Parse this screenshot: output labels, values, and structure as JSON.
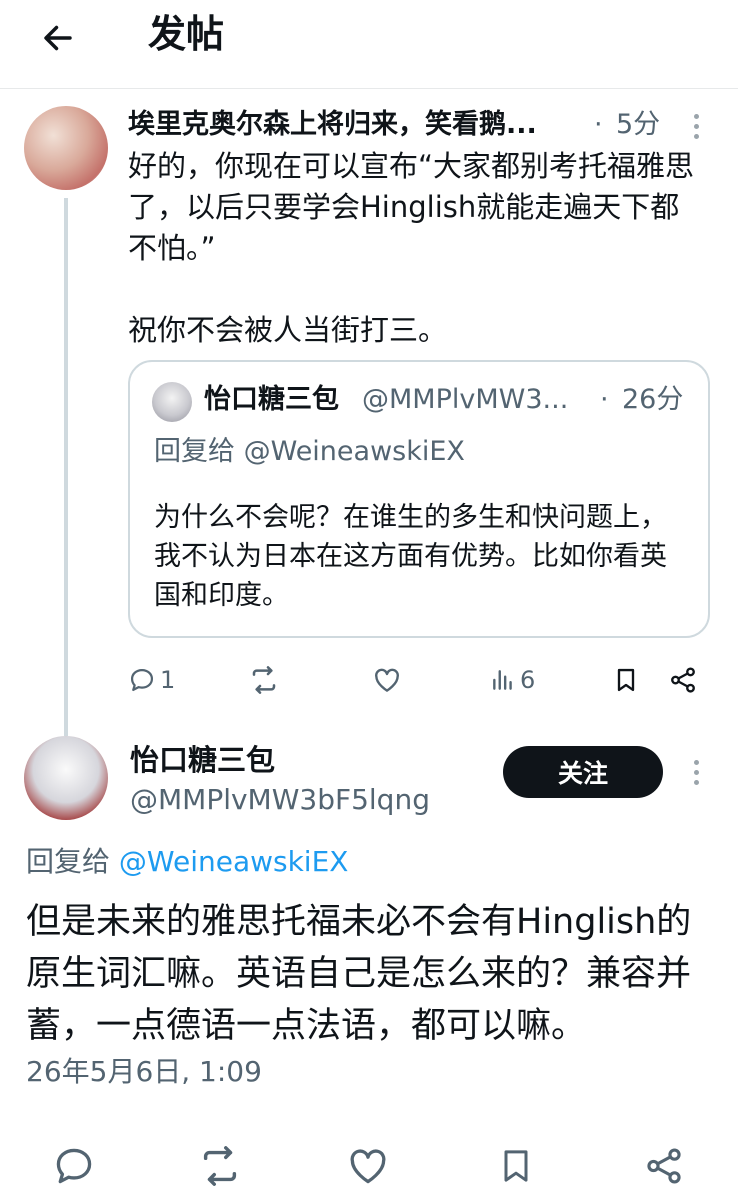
{
  "header": {
    "title": "发帖"
  },
  "parent_post": {
    "display_name": "埃里克奥尔森上将归来，笑看鹅...",
    "separator": "·",
    "time": "5分",
    "text": "好的，你现在可以宣布“大家都别考托福雅思了，以后只要学会Hinglish就能走遍天下都不怕。”\n\n祝你不会被人当街打三。",
    "quote": {
      "display_name": "怡口糖三包",
      "handle": "@MMPlvMW3...",
      "separator": "·",
      "time": "26分",
      "reply_to": "回复给 @WeineawskiEX",
      "text": "为什么不会呢？在谁生的多生和快问题上，我不认为日本在这方面有优势。比如你看英国和印度。"
    },
    "actions": {
      "reply_count": "1",
      "views_count": "6"
    }
  },
  "main_post": {
    "display_name": "怡口糖三包",
    "handle": "@MMPlvMW3bF5lqng",
    "follow_label": "关注",
    "reply_prefix": "回复给",
    "reply_mention": "@WeineawskiEX",
    "text": "但是未来的雅思托福未必不会有Hinglish的原生词汇嘛。英语自己是怎么来的？兼容并蓄，一点德语一点法语，都可以嘛。",
    "timestamp": "26年5月6日, 1:09"
  },
  "colors": {
    "text": "#0f1419",
    "secondary": "#536471",
    "link": "#1d9bf0",
    "border": "#cfd9de",
    "button_bg": "#0f1419"
  },
  "icons": [
    "back-arrow-icon",
    "more-vertical-icon",
    "reply-icon",
    "repost-icon",
    "like-icon",
    "views-icon",
    "bookmark-icon",
    "share-icon"
  ]
}
